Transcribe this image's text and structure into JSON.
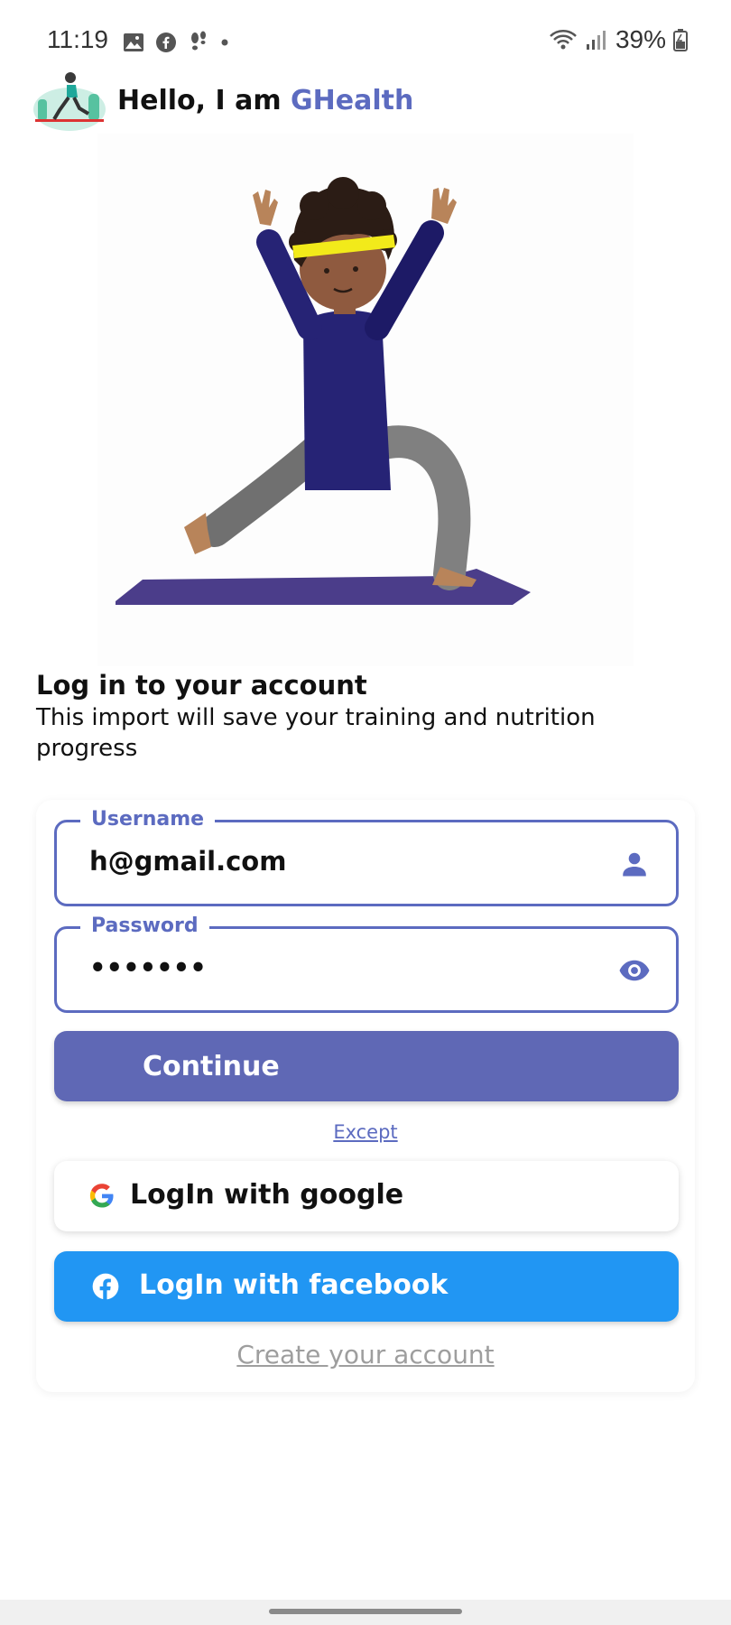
{
  "status_bar": {
    "time": "11:19",
    "battery": "39%",
    "icons": [
      "image-icon",
      "facebook-icon",
      "footsteps-icon",
      "dot-icon",
      "wifi-icon",
      "signal-icon",
      "battery-icon"
    ]
  },
  "header": {
    "greeting": "Hello, I am ",
    "brand": "GHealth"
  },
  "login": {
    "title": "Log in to your account",
    "subtitle": "This import will save your training and nutrition progress"
  },
  "form": {
    "username_label": "Username",
    "username_value": "h@gmail.com",
    "password_label": "Password",
    "password_value": "•••••••",
    "continue_label": "Continue",
    "except_link": "Except",
    "google_label": "LogIn with google",
    "facebook_label": "LogIn with facebook",
    "create_account": "Create your account"
  },
  "colors": {
    "accent": "#5c6bc0",
    "continue_bg": "#5f68b5",
    "facebook_bg": "#2196f3"
  }
}
